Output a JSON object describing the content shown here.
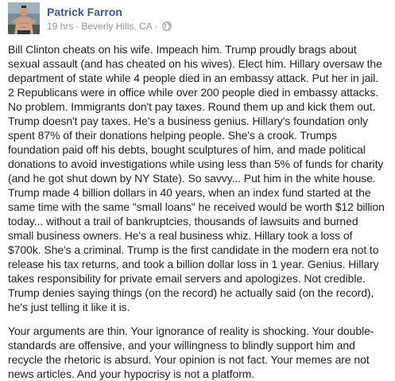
{
  "post": {
    "author": "Patrick Farron",
    "timestamp": "19 hrs",
    "separator": "·",
    "location": "Beverly Hills, CA",
    "privacy_icon": "globe-icon",
    "paragraphs": [
      "Bill Clinton cheats on his wife. Impeach him. Trump proudly brags about sexual assault (and has cheated on his wives). Elect him. Hillary oversaw the department of state while 4 people died in an embassy attack. Put her in jail. 2 Republicans were in office while over 200 people died in embassy attacks. No problem. Immigrants don't pay taxes. Round them up and kick them out. Trump doesn't pay taxes. He's a business genius. Hillary's foundation only spent 87% of their donations helping people. She's a crook. Trumps foundation paid off his debts, bought sculptures of him, and made political donations to avoid investigations while using less than 5% of funds for charity (and he got shut down by NY State). So savvy... Put him in the white house. Trump made 4 billion dollars in 40 years, when an index fund started at the same time with the same \"small loans\" he received would be worth $12 billion today... without a trail of bankruptcies, thousands of lawsuits and burned small business owners. He's a real business whiz. Hillary took a loss of $700k. She's a criminal. Trump is the first candidate in the modern era not to release his tax returns, and took a billion dollar loss in 1 year. Genius. Hillary takes responsibility for private email servers and apologizes. Not credible. Trump denies saying things (on the record) he actually said (on the record), he's just telling it like it is.",
      "Your arguments are thin. Your ignorance of reality is shocking. Your double-standards are offensive, and your willingness to blindly support him and recycle the rhetoric is absurd. Your opinion is not fact. Your memes are not news articles. And your hypocrisy is not a platform."
    ]
  },
  "colors": {
    "author_link": "#365899",
    "meta_text": "#90949c",
    "body_text": "#1d2129",
    "background": "#ffffff"
  }
}
